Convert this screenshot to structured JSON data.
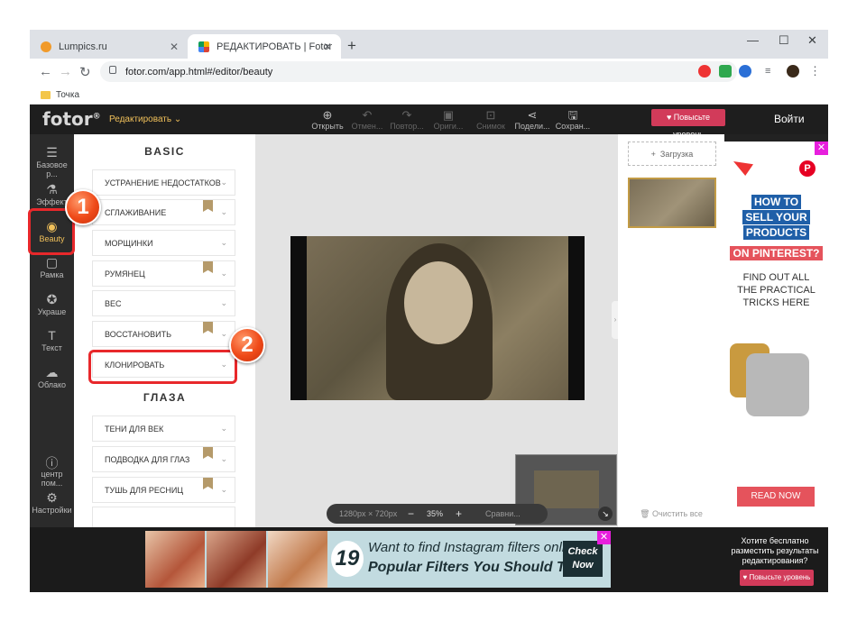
{
  "browser": {
    "tabs": [
      {
        "title": "Lumpics.ru"
      },
      {
        "title": "РЕДАКТИРОВАТЬ | Fotor"
      }
    ],
    "url": "fotor.com/app.html#/editor/beauty",
    "bookmark": "Точка"
  },
  "app": {
    "logo": "fotor",
    "mode": "Редактировать",
    "toolbar": [
      {
        "label": "Открыть",
        "icon": "open-icon"
      },
      {
        "label": "Отмен...",
        "icon": "undo-icon"
      },
      {
        "label": "Повтор...",
        "icon": "redo-icon"
      },
      {
        "label": "Ориги...",
        "icon": "original-icon"
      },
      {
        "label": "Снимок",
        "icon": "snapshot-icon"
      },
      {
        "label": "Подели...",
        "icon": "share-icon"
      },
      {
        "label": "Сохран...",
        "icon": "save-icon"
      }
    ],
    "upgrade": "Повысьте уровень",
    "login": "Войти"
  },
  "sidebar": {
    "items": [
      {
        "label": "Базовое р...",
        "icon": "sliders-icon"
      },
      {
        "label": "Эффект",
        "icon": "flask-icon"
      },
      {
        "label": "Beauty",
        "icon": "eye-icon"
      },
      {
        "label": "Рамка",
        "icon": "frame-icon"
      },
      {
        "label": "Украше",
        "icon": "sticker-icon"
      },
      {
        "label": "Текст",
        "icon": "text-icon"
      },
      {
        "label": "Облако",
        "icon": "cloud-icon"
      },
      {
        "label": "центр пом...",
        "icon": "help-icon"
      },
      {
        "label": "Настройки",
        "icon": "settings-icon"
      }
    ]
  },
  "panel": {
    "section_basic": "BASIC",
    "basic_items": [
      {
        "label": "УСТРАНЕНИЕ НЕДОСТАТКОВ"
      },
      {
        "label": "СГЛАЖИВАНИЕ"
      },
      {
        "label": "МОРЩИНКИ"
      },
      {
        "label": "РУМЯНЕЦ"
      },
      {
        "label": "ВЕС"
      },
      {
        "label": "ВОССТАНОВИТЬ"
      },
      {
        "label": "КЛОНИРОВАТЬ"
      }
    ],
    "section_eyes": "ГЛАЗА",
    "eye_items": [
      {
        "label": "ТЕНИ ДЛЯ ВЕК"
      },
      {
        "label": "ПОДВОДКА ДЛЯ ГЛАЗ"
      },
      {
        "label": "ТУШЬ ДЛЯ РЕСНИЦ"
      }
    ]
  },
  "canvas": {
    "dimensions": "1280px × 720px",
    "zoom": "35%",
    "compare": "Сравни..."
  },
  "right_panel": {
    "upload": "Загрузка",
    "clear_all": "Очистить все"
  },
  "ad_right": {
    "line1": "HOW TO",
    "line2": "SELL YOUR",
    "line3": "PRODUCTS",
    "line4": "ON PINTEREST?",
    "sub": "FIND OUT ALL THE PRACTICAL TRICKS HERE",
    "cta": "READ NOW"
  },
  "ad_bottom": {
    "number": "19",
    "line1": "Want to find Instagram filters online?",
    "line2": "Popular Filters You Should Try",
    "check": "Check Now"
  },
  "promo": {
    "text": "Хотите бесплатно разместить результаты редактирования?",
    "button": "Повысьте уровень"
  },
  "callouts": {
    "step1": "1",
    "step2": "2"
  },
  "colors": {
    "accent": "#f0c05a",
    "upgrade": "#d23b5a",
    "callout": "#e8282b"
  }
}
